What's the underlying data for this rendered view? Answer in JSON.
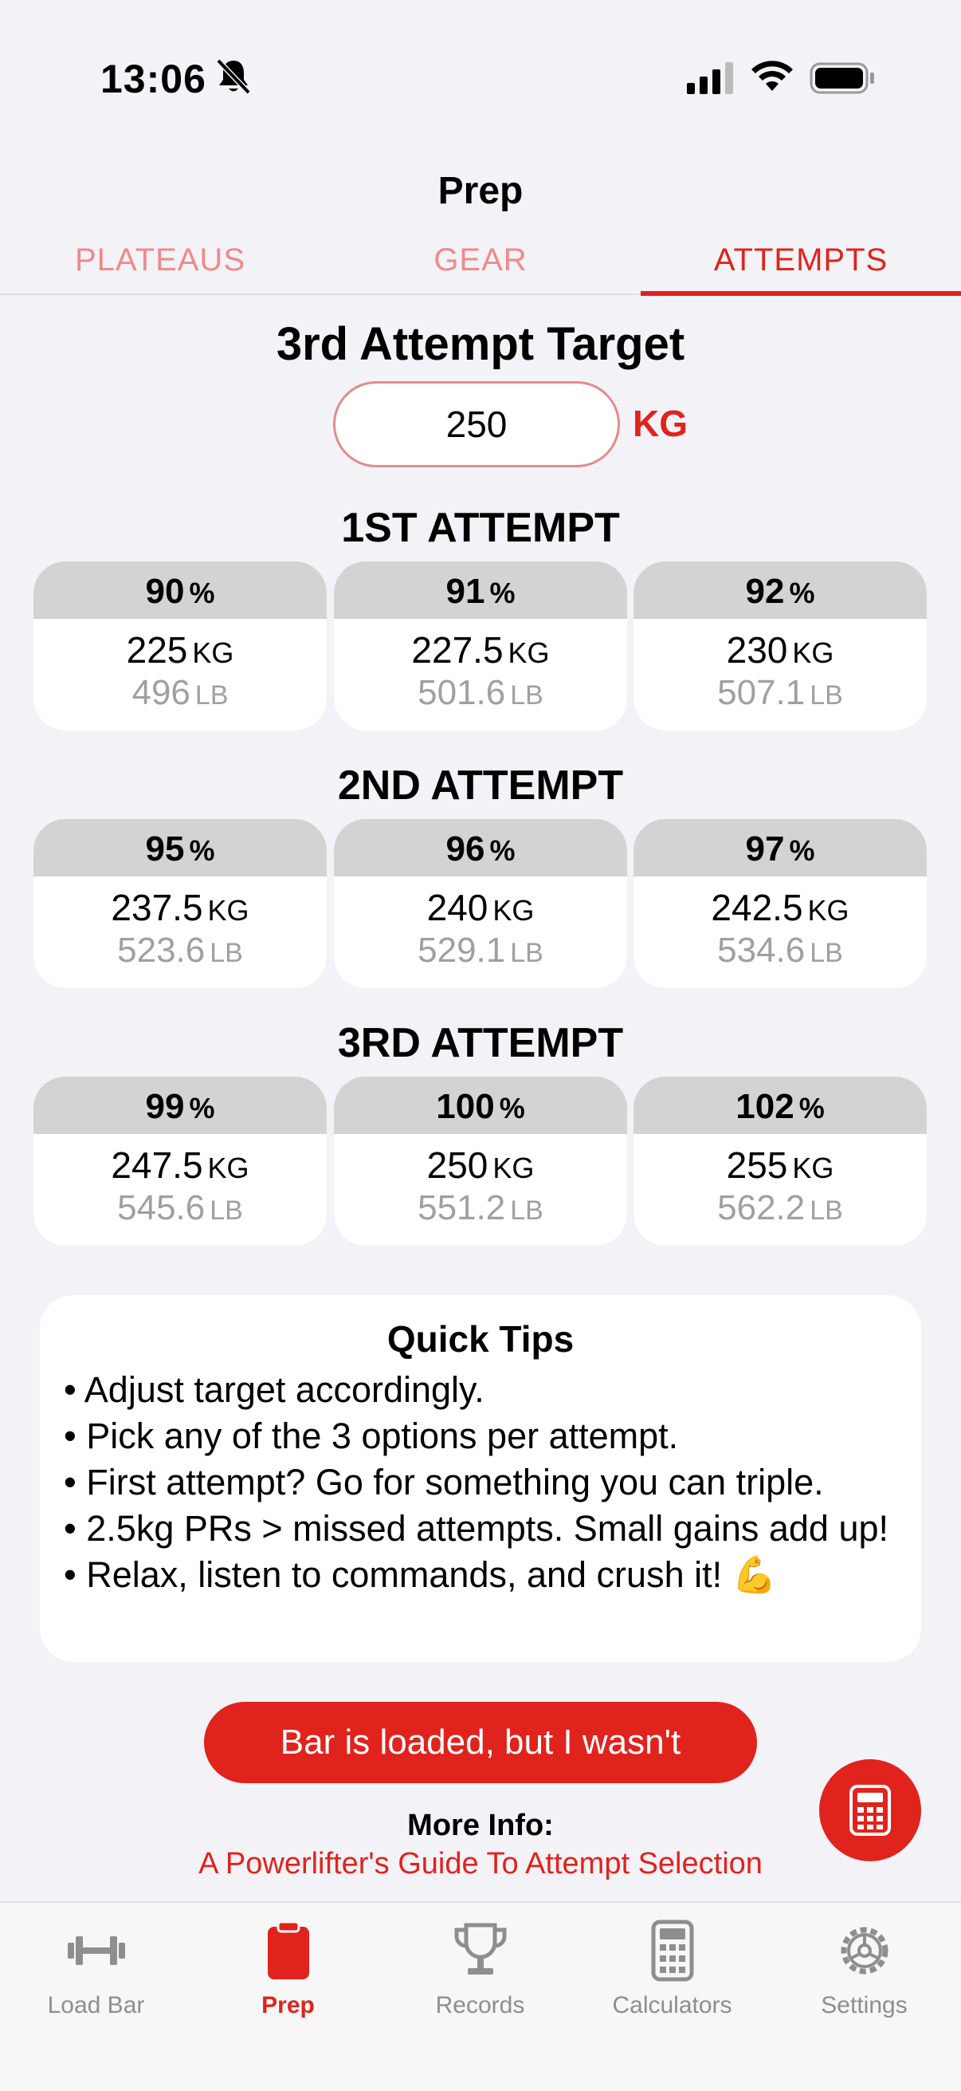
{
  "status": {
    "time": "13:06"
  },
  "nav": {
    "title": "Prep"
  },
  "tabs": [
    {
      "label": "PLATEAUS"
    },
    {
      "label": "GEAR"
    },
    {
      "label": "ATTEMPTS"
    }
  ],
  "target": {
    "title": "3rd Attempt Target",
    "value": "250",
    "unit": "KG"
  },
  "units": {
    "kg": "KG",
    "lb": "LB",
    "pct": "%"
  },
  "attempts": [
    {
      "heading": "1ST ATTEMPT",
      "options": [
        {
          "pct": "90",
          "kg": "225",
          "lb": "496"
        },
        {
          "pct": "91",
          "kg": "227.5",
          "lb": "501.6"
        },
        {
          "pct": "92",
          "kg": "230",
          "lb": "507.1"
        }
      ]
    },
    {
      "heading": "2ND ATTEMPT",
      "options": [
        {
          "pct": "95",
          "kg": "237.5",
          "lb": "523.6"
        },
        {
          "pct": "96",
          "kg": "240",
          "lb": "529.1"
        },
        {
          "pct": "97",
          "kg": "242.5",
          "lb": "534.6"
        }
      ]
    },
    {
      "heading": "3RD ATTEMPT",
      "options": [
        {
          "pct": "99",
          "kg": "247.5",
          "lb": "545.6"
        },
        {
          "pct": "100",
          "kg": "250",
          "lb": "551.2"
        },
        {
          "pct": "102",
          "kg": "255",
          "lb": "562.2"
        }
      ]
    }
  ],
  "tips": {
    "title": "Quick Tips",
    "items": [
      "• Adjust target accordingly.",
      "• Pick any of the 3 options per attempt.",
      "• First attempt? Go for something you can triple.",
      "• 2.5kg PRs > missed attempts. Small gains add up!",
      "• Relax, listen to commands, and crush it! 💪"
    ]
  },
  "loaded_button": "Bar is loaded, but I wasn't",
  "more_info": {
    "label": "More Info:",
    "link": "A Powerlifter's Guide To Attempt Selection"
  },
  "tabbar": [
    {
      "label": "Load Bar",
      "icon": "barbell-icon"
    },
    {
      "label": "Prep",
      "icon": "clipboard-icon"
    },
    {
      "label": "Records",
      "icon": "trophy-icon"
    },
    {
      "label": "Calculators",
      "icon": "calculator-icon"
    },
    {
      "label": "Settings",
      "icon": "gear-icon"
    }
  ],
  "colors": {
    "accent": "#e0231c",
    "tab_inactive": "#ef8a8a",
    "card_header": "#d3d3d3",
    "background": "#f2f2f7"
  }
}
